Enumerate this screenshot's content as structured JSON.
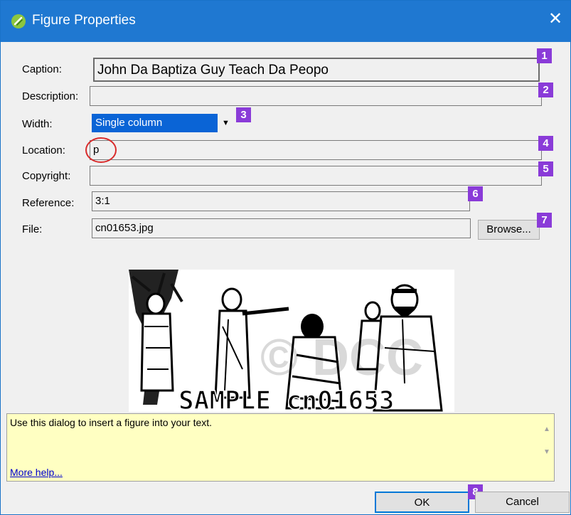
{
  "window": {
    "title": "Figure Properties",
    "close_glyph": "✕"
  },
  "fields": {
    "caption": {
      "label": "Caption:",
      "value": "John Da Baptiza Guy Teach Da Peopo",
      "badge": "1"
    },
    "description": {
      "label": "Description:",
      "value": "",
      "badge": "2"
    },
    "width": {
      "label": "Width:",
      "value": "Single column",
      "badge": "3"
    },
    "location": {
      "label": "Location:",
      "value": "p",
      "badge": "4"
    },
    "copyright": {
      "label": "Copyright:",
      "value": "",
      "badge": "5"
    },
    "reference": {
      "label": "Reference:",
      "value": "3:1",
      "badge": "6"
    },
    "file": {
      "label": "File:",
      "value": "cn01653.jpg",
      "badge": "7",
      "browse_label": "Browse..."
    }
  },
  "preview": {
    "watermark": "SAMPLE cn01653",
    "faint_mark": "© DCC"
  },
  "help": {
    "text": "Use this dialog to insert a figure into your text.",
    "more_link": "More help..."
  },
  "buttons": {
    "ok": "OK",
    "ok_badge": "8",
    "cancel": "Cancel"
  },
  "colors": {
    "titlebar": "#1f78d1",
    "badge": "#8a3bd8",
    "selection": "#0a64d6",
    "highlight_circle": "#d92b2b",
    "help_bg": "#ffffc2"
  }
}
